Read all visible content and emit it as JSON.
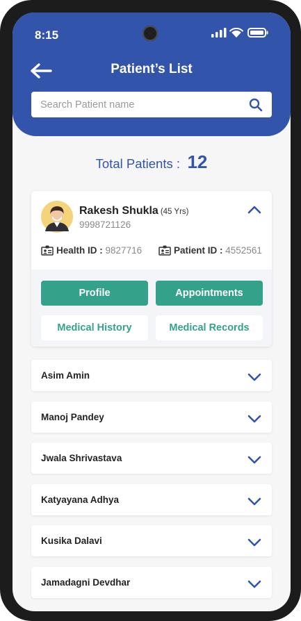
{
  "status_bar": {
    "time": "8:15"
  },
  "header": {
    "title": "Patient’s List",
    "search_placeholder": "Search Patient name"
  },
  "summary": {
    "label": "Total Patients :",
    "count": "12"
  },
  "expanded_patient": {
    "name": "Rakesh Shukla",
    "age": "(45 Yrs)",
    "phone": "9998721126",
    "health_id_label": "Health ID :",
    "health_id": "9827716",
    "patient_id_label": "Patient ID :",
    "patient_id": "4552561",
    "buttons": {
      "profile": "Profile",
      "appointments": "Appointments",
      "medical_history": "Medical History",
      "medical_records": "Medical Records"
    }
  },
  "patients": [
    {
      "name": "Asim Amin"
    },
    {
      "name": "Manoj Pandey"
    },
    {
      "name": "Jwala Shrivastava"
    },
    {
      "name": "Katyayana Adhya"
    },
    {
      "name": "Kusika Dalavi"
    },
    {
      "name": "Jamadagni Devdhar"
    }
  ],
  "icons": {
    "back": "arrow-left-icon",
    "search": "search-icon",
    "expand": "chevron-down-icon",
    "collapse": "chevron-up-icon",
    "id_card": "id-card-icon",
    "signal": "signal-icon",
    "wifi": "wifi-icon",
    "battery": "battery-icon"
  },
  "colors": {
    "primary_blue": "#3255ab",
    "accent_green": "#34a28b",
    "frame": "#1c1c1c"
  }
}
